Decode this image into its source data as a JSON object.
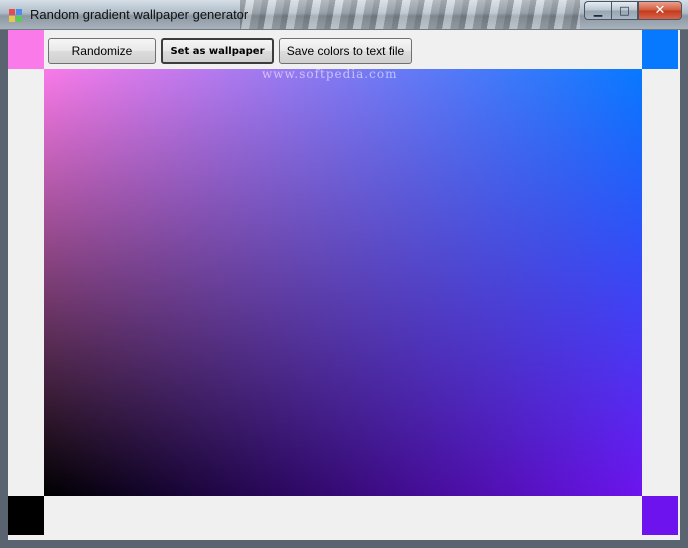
{
  "window": {
    "title": "Random gradient wallpaper generator",
    "controls": {
      "minimize": "▁",
      "maximize": "□",
      "close": "✕"
    }
  },
  "toolbar": {
    "randomize_label": "Randomize",
    "set_wallpaper_label": "Set as wallpaper",
    "save_colors_label": "Save colors to text file"
  },
  "watermark": "www.softpedia.com",
  "colors": {
    "top_left": "#f97ae8",
    "top_right": "#0779ff",
    "bottom_left": "#000000",
    "bottom_right": "#6d14ee"
  }
}
